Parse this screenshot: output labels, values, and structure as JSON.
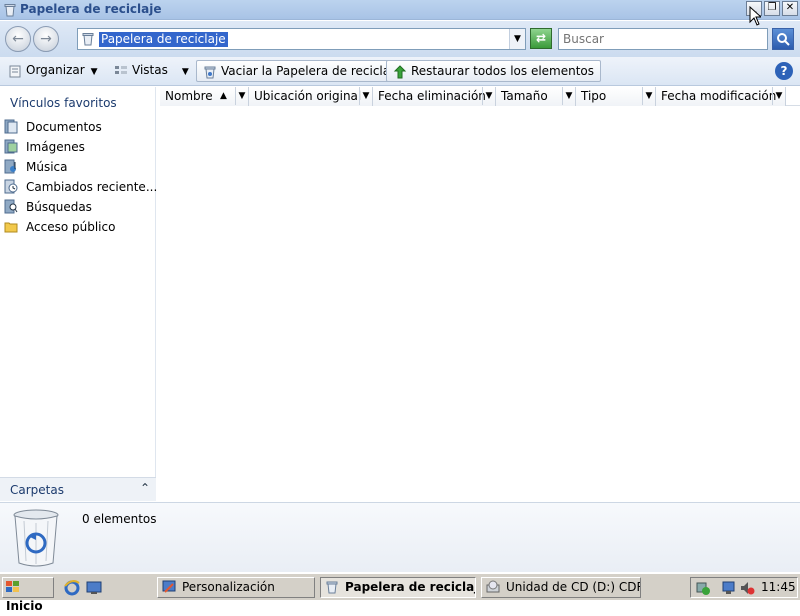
{
  "window": {
    "title": "Papelera de reciclaje",
    "buttons": {
      "minimize": "_",
      "restore": "❐",
      "close": "✕"
    }
  },
  "address_bar": {
    "back_glyph": "←",
    "forward_glyph": "→",
    "path": "Papelera de reciclaje",
    "dropdown_glyph": "▼",
    "go_glyph": "⇄",
    "search_placeholder": "Buscar",
    "search_glyph": "🔍"
  },
  "toolbar": {
    "organize": "Organizar",
    "views": "Vistas",
    "empty_bin": "Vaciar la Papelera de reciclaje",
    "restore_all": "Restaurar todos los elementos",
    "help": "?"
  },
  "left_pane": {
    "favorites_title": "Vínculos favoritos",
    "favorites": [
      {
        "label": "Documentos",
        "icon": "documents-icon"
      },
      {
        "label": "Imágenes",
        "icon": "pictures-icon"
      },
      {
        "label": "Música",
        "icon": "music-icon"
      },
      {
        "label": "Cambiados reciente...",
        "icon": "recent-icon"
      },
      {
        "label": "Búsquedas",
        "icon": "searches-icon"
      },
      {
        "label": "Acceso público",
        "icon": "public-folder-icon"
      }
    ],
    "folders_label": "Carpetas",
    "folders_chevron": "⌃"
  },
  "columns": [
    {
      "label": "Nombre"
    },
    {
      "label": "Ubicación original"
    },
    {
      "label": "Fecha eliminación"
    },
    {
      "label": "Tamaño"
    },
    {
      "label": "Tipo"
    },
    {
      "label": "Fecha modificación"
    }
  ],
  "details": {
    "item_count": "0 elementos"
  },
  "taskbar": {
    "start_label": "Inicio",
    "tasks": [
      {
        "label": "Personalización",
        "active": false
      },
      {
        "label": "Papelera de reciclaje",
        "active": true
      },
      {
        "label": "Unidad de CD (D:) CDR...",
        "active": false
      }
    ],
    "clock": "11:45"
  },
  "colors": {
    "accent": "#3366cc",
    "title_text": "#2b4f8c"
  }
}
